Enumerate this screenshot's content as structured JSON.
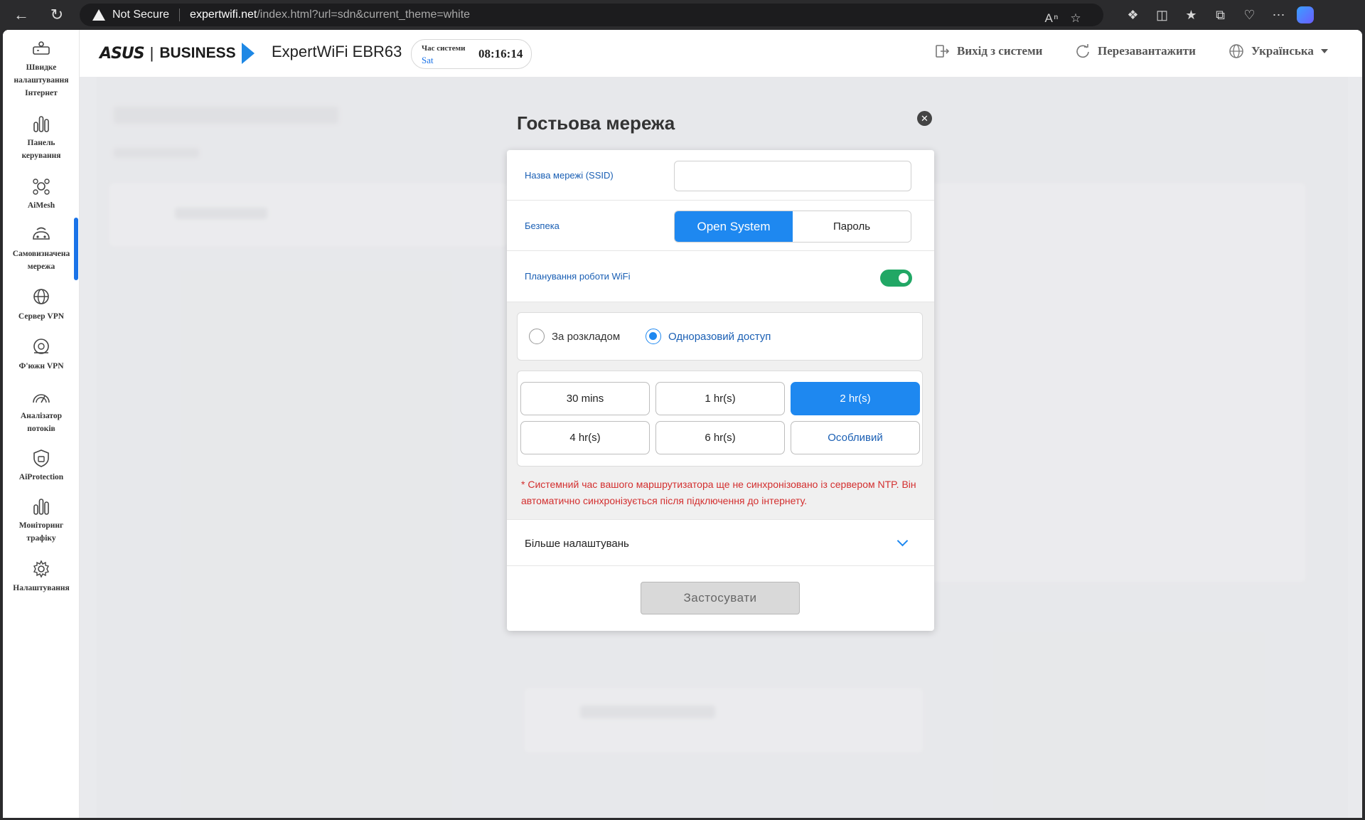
{
  "browser": {
    "security_label": "Not Secure",
    "url_host": "expertwifi.net",
    "url_path": "/index.html?url=sdn&current_theme=white"
  },
  "brand": {
    "logo": "ASUS",
    "business": "BUSINESS",
    "model": "ExpertWiFi EBR63"
  },
  "system_time": {
    "label": "Час системи",
    "day": "Sat",
    "time": "08:16:14"
  },
  "header_actions": {
    "logout": "Вихід з системи",
    "reboot": "Перезавантажити",
    "language": "Українська"
  },
  "sidebar": {
    "items": [
      {
        "label": "Швидке налаштування Інтернет",
        "icon": "router-setup-icon"
      },
      {
        "label": "Панель керування",
        "icon": "bar-chart-icon"
      },
      {
        "label": "AiMesh",
        "icon": "mesh-icon"
      },
      {
        "label": "Самовизначена мережа",
        "icon": "network-icon"
      },
      {
        "label": "Сервер VPN",
        "icon": "vpn-globe-icon"
      },
      {
        "label": "Ф'южн VPN",
        "icon": "fusion-vpn-icon"
      },
      {
        "label": "Аналізатор потоків",
        "icon": "speedometer-icon"
      },
      {
        "label": "AiProtection",
        "icon": "shield-icon"
      },
      {
        "label": "Моніторинг трафіку",
        "icon": "traffic-chart-icon"
      },
      {
        "label": "Налаштування",
        "icon": "settings-gear-icon"
      }
    ],
    "active_index": 3
  },
  "modal": {
    "title": "Гостьова мережа",
    "ssid_label": "Назва мережі (SSID)",
    "ssid_value": "",
    "security_label": "Безпека",
    "security_options": [
      "Open System",
      "Пароль"
    ],
    "security_selected": "Open System",
    "schedule_label": "Планування роботи WiFi",
    "schedule_enabled": true,
    "schedule_modes": [
      "За розкладом",
      "Одноразовий доступ"
    ],
    "schedule_mode_selected": "Одноразовий доступ",
    "durations": [
      "30 mins",
      "1 hr(s)",
      "2 hr(s)",
      "4 hr(s)",
      "6 hr(s)",
      "Особливий"
    ],
    "duration_selected": "2 hr(s)",
    "warning": "* Системний час вашого маршрутизатора ще не синхронізовано із сервером NTP. Він автоматично синхронізується після підключення до інтернету.",
    "more_settings": "Більше налаштувань",
    "apply": "Застосувати"
  },
  "colors": {
    "accent": "#1e88f0",
    "toggle_on": "#21a765",
    "warning": "#d32f2f"
  }
}
